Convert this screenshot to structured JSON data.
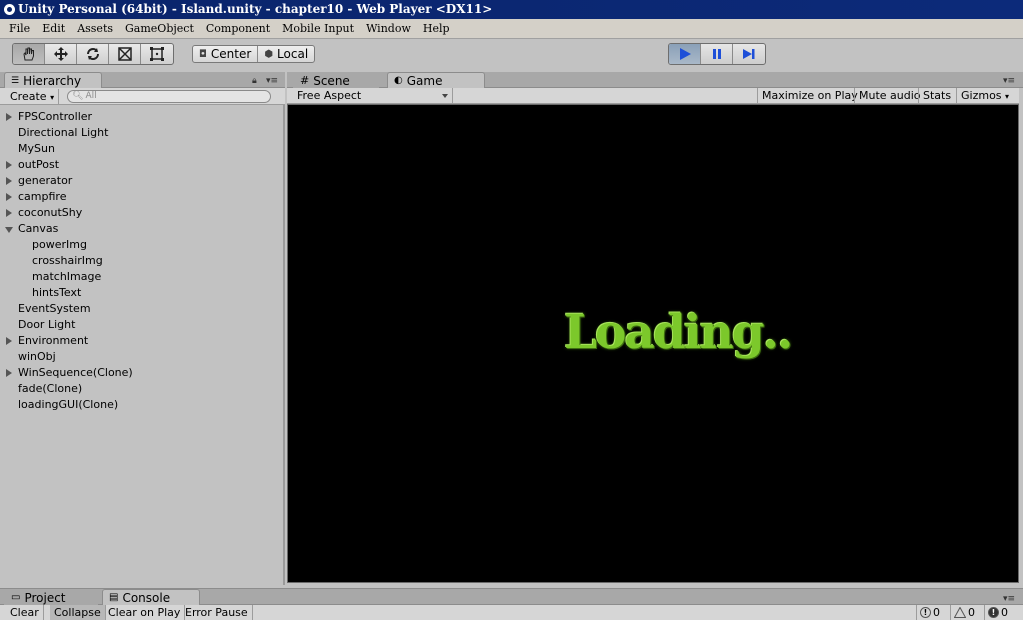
{
  "window": {
    "title": "Unity Personal (64bit) - Island.unity - chapter10 - Web Player <DX11>"
  },
  "menu": [
    "File",
    "Edit",
    "Assets",
    "GameObject",
    "Component",
    "Mobile Input",
    "Window",
    "Help"
  ],
  "toolbar": {
    "tools": [
      "hand-tool",
      "move-tool",
      "rotate-tool",
      "scale-tool",
      "rect-tool"
    ],
    "pivot_center": "Center",
    "pivot_local": "Local"
  },
  "hierarchy": {
    "tab": "Hierarchy",
    "create": "Create",
    "search_placeholder": "All",
    "items": [
      {
        "label": "FPSController",
        "fold": "closed",
        "child": false
      },
      {
        "label": "Directional Light",
        "fold": "none",
        "child": false
      },
      {
        "label": "MySun",
        "fold": "none",
        "child": false
      },
      {
        "label": "outPost",
        "fold": "closed",
        "child": false
      },
      {
        "label": "generator",
        "fold": "closed",
        "child": false
      },
      {
        "label": "campfire",
        "fold": "closed",
        "child": false
      },
      {
        "label": "coconutShy",
        "fold": "closed",
        "child": false
      },
      {
        "label": "Canvas",
        "fold": "open",
        "child": false
      },
      {
        "label": "powerImg",
        "fold": "none",
        "child": true
      },
      {
        "label": "crosshairImg",
        "fold": "none",
        "child": true
      },
      {
        "label": "matchImage",
        "fold": "none",
        "child": true
      },
      {
        "label": "hintsText",
        "fold": "none",
        "child": true
      },
      {
        "label": "EventSystem",
        "fold": "none",
        "child": false
      },
      {
        "label": "Door Light",
        "fold": "none",
        "child": false
      },
      {
        "label": "Environment",
        "fold": "closed",
        "child": false
      },
      {
        "label": "winObj",
        "fold": "none",
        "child": false
      },
      {
        "label": "WinSequence(Clone)",
        "fold": "closed",
        "child": false
      },
      {
        "label": "fade(Clone)",
        "fold": "none",
        "child": false
      },
      {
        "label": "loadingGUI(Clone)",
        "fold": "none",
        "child": false
      }
    ]
  },
  "view_tabs": {
    "scene": "Scene",
    "game": "Game"
  },
  "game_toolbar": {
    "aspect": "Free Aspect",
    "maximize": "Maximize on Play",
    "mute": "Mute audio",
    "stats": "Stats",
    "gizmos": "Gizmos"
  },
  "game_view": {
    "loading_text": "Loading.."
  },
  "bottom_tabs": {
    "project": "Project",
    "console": "Console"
  },
  "console": {
    "clear": "Clear",
    "collapse": "Collapse",
    "clear_on_play": "Clear on Play",
    "error_pause": "Error Pause",
    "info_count": "0",
    "warning_count": "0",
    "error_count": "0"
  }
}
